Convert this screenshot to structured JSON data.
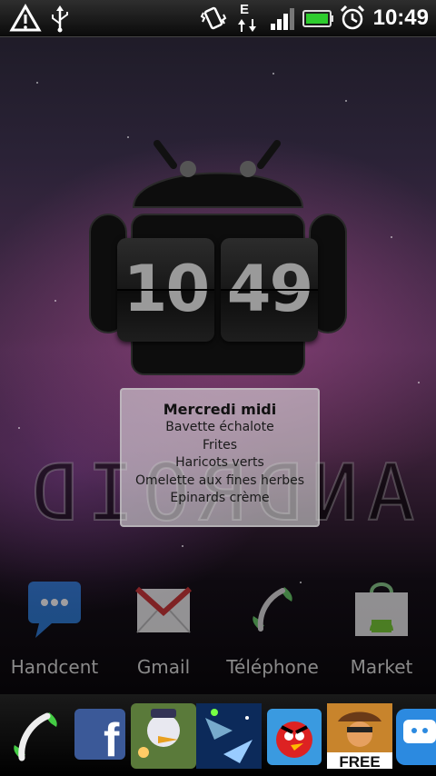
{
  "status_bar": {
    "time": "10:49",
    "network_type": "E",
    "icons": [
      "warning-icon",
      "usb-icon",
      "vibrate-icon",
      "data-transfer-icon",
      "signal-icon",
      "battery-icon",
      "alarm-icon"
    ]
  },
  "clock_widget": {
    "hours": "10",
    "minutes": "49"
  },
  "menu_widget": {
    "title": "Mercredi midi",
    "items": [
      "Bavette échalote",
      "Frites",
      "Haricots verts",
      "Omelette aux fines herbes",
      "Epinards crème"
    ]
  },
  "wallpaper_text": "ANDROID",
  "dock": {
    "shortcuts": [
      {
        "label": "Handcent",
        "icon": "handcent-icon"
      },
      {
        "label": "Gmail",
        "icon": "gmail-icon"
      },
      {
        "label": "Téléphone",
        "icon": "phone-icon"
      },
      {
        "label": "Market",
        "icon": "market-icon"
      }
    ]
  },
  "bottom_bar": {
    "apps": [
      {
        "icon": "phone-dialer-icon"
      },
      {
        "icon": "facebook-icon"
      },
      {
        "icon": "duck-game-icon"
      },
      {
        "icon": "space-game-icon"
      },
      {
        "icon": "angry-birds-icon"
      },
      {
        "icon": "cowboy-game-icon",
        "badge": "FREE"
      },
      {
        "icon": "chat-app-icon"
      }
    ]
  }
}
